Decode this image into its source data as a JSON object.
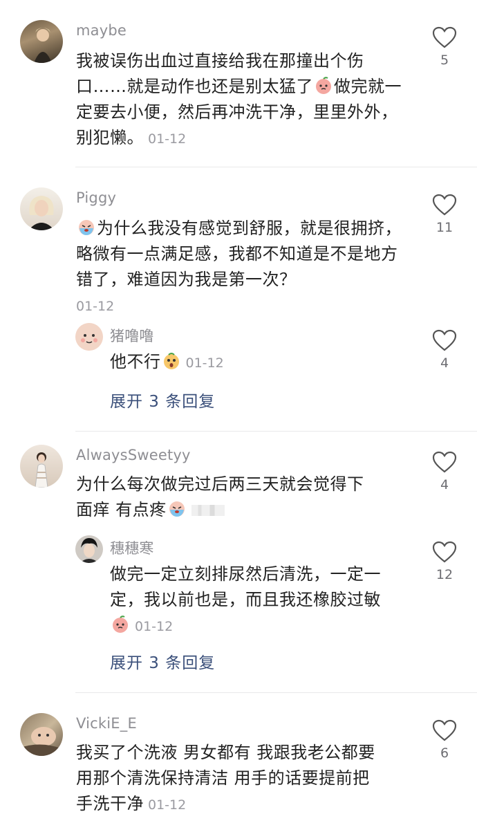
{
  "comments": [
    {
      "user": "maybe",
      "text_before": "我被误伤出血过直接给我在那撞出个伤口……就是动作也还是别太猛了",
      "text_after": "做完就一定要去小便，然后再冲洗干净，里里外外，别犯懒。",
      "time": "01-12",
      "likes": "5",
      "emoji": "peach-face-emoji"
    },
    {
      "user": "Piggy",
      "text": "为什么我没有感觉到舒服，就是很拥挤，略微有一点满足感，我都不知道是不是地方错了，难道因为我是第一次？",
      "time": "01-12",
      "likes": "11",
      "emoji": "crying-face-emoji",
      "reply": {
        "user": "猪噜噜",
        "text": "他不行",
        "time": "01-12",
        "likes": "4",
        "emoji": "shocked-face-emoji"
      },
      "expand_label": "展开 3 条回复"
    },
    {
      "user": "AlwaysSweetyy",
      "text_line1": "为什么每次做完过后两三天就会觉得下",
      "text_line2": "面痒 有点疼",
      "likes": "4",
      "emoji": "crying-face-emoji",
      "reply": {
        "user": "穗穗寒",
        "text_line1": "做完一定立刻排尿然后清洗，一定一",
        "text_line2": "定，我以前也是，而且我还橡胶过敏",
        "time": "01-12",
        "likes": "12",
        "emoji": "peach-face-emoji"
      },
      "expand_label": "展开 3 条回复"
    },
    {
      "user": "VickiE_E",
      "text_line1": "我买了个洗液 男女都有 我跟我老公都要",
      "text_line2": "用那个清洗保持清洁 用手的话要提前把",
      "text_line3": "手洗干净",
      "time": "01-12",
      "likes": "6"
    }
  ],
  "colors": {
    "username": "#8e8e93",
    "text": "#222222",
    "link": "#3a4f7a",
    "divider": "#e8e8ea"
  }
}
